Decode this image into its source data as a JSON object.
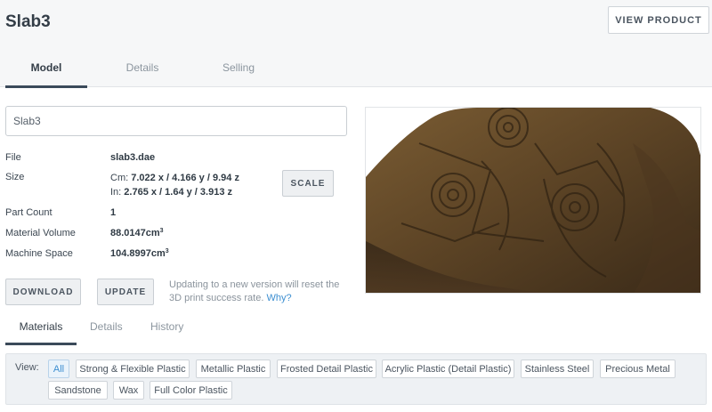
{
  "header": {
    "title": "Slab3",
    "view_product_label": "VIEW PRODUCT",
    "tabs": [
      "Model",
      "Details",
      "Selling"
    ]
  },
  "model": {
    "name_value": "Slab3",
    "file_label": "File",
    "file_value": "slab3.dae",
    "size_label": "Size",
    "size_cm_prefix": "Cm:",
    "size_cm_value": "7.022 x / 4.166 y / 9.94 z",
    "size_in_prefix": "In:",
    "size_in_value": "2.765 x / 1.64 y / 3.913 z",
    "part_count_label": "Part Count",
    "part_count_value": "1",
    "material_volume_label": "Material Volume",
    "material_volume_value": "88.0147cm",
    "machine_space_label": "Machine Space",
    "machine_space_value": "104.8997cm",
    "cubic_superscript": "3",
    "scale_label": "SCALE",
    "download_label": "DOWNLOAD",
    "update_label": "UPDATE",
    "update_note": "Updating to a new version will reset the 3D print success rate.",
    "why_link": "Why?"
  },
  "sub_tabs": [
    "Materials",
    "Details",
    "History"
  ],
  "materials": {
    "view_label": "View:",
    "filters": [
      "All",
      "Strong & Flexible Plastic",
      "Metallic Plastic",
      "Frosted Detail Plastic",
      "Acrylic Plastic (Detail Plastic)",
      "Stainless Steel",
      "Precious Metal",
      "Sandstone",
      "Wax",
      "Full Color Plastic"
    ],
    "selected": "All"
  },
  "colors": {
    "accent": "#3d8fd1",
    "tab_underline": "#3b4a5a",
    "stone": "#5e4526"
  }
}
